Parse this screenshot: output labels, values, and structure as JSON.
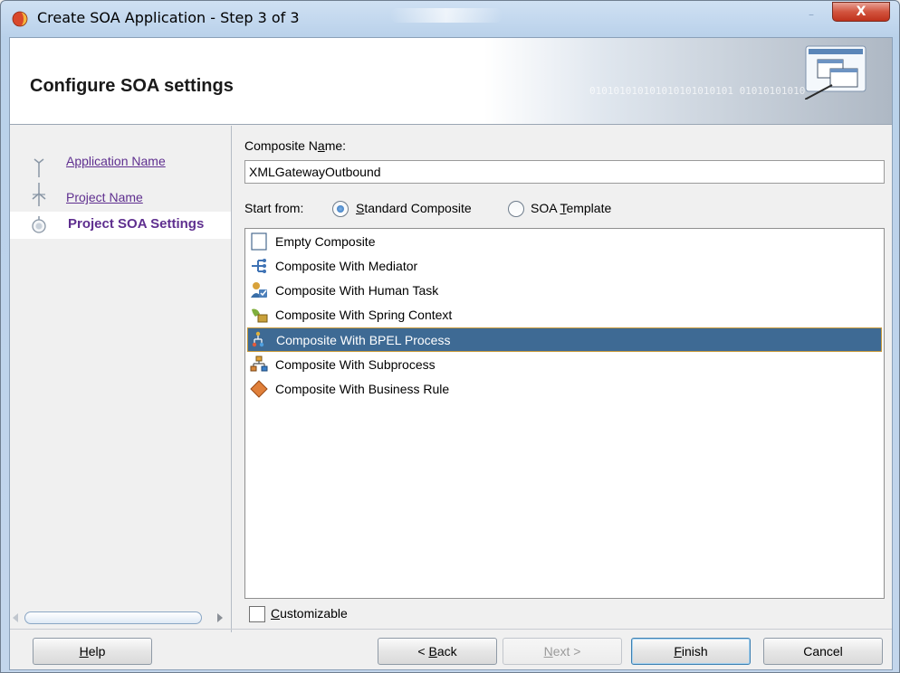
{
  "window": {
    "title": "Create SOA Application - Step 3 of 3",
    "minimize_glyph": "–",
    "close_glyph": "X"
  },
  "header": {
    "title": "Configure SOA settings",
    "decor_bits": "010101010101010101010101  01010101010"
  },
  "nav": {
    "items": [
      {
        "label": "Application Name",
        "state": "visited"
      },
      {
        "label": "Project Name",
        "state": "visited"
      },
      {
        "label": "Project SOA Settings",
        "state": "current"
      }
    ]
  },
  "form": {
    "composite_name_label_pre": "Composite N",
    "composite_name_label_mnemonic": "a",
    "composite_name_label_post": "me:",
    "composite_name_value": "XMLGatewayOutbound",
    "start_from_label": "Start from:",
    "radio_standard": {
      "mnemonic": "S",
      "rest": "tandard Composite",
      "checked": true
    },
    "radio_template": {
      "pre": "SOA ",
      "mnemonic": "T",
      "rest": "emplate",
      "checked": false
    },
    "composite_types": [
      {
        "label": "Empty Composite",
        "icon": "empty-composite-icon"
      },
      {
        "label": "Composite With Mediator",
        "icon": "mediator-icon"
      },
      {
        "label": "Composite With Human Task",
        "icon": "human-task-icon"
      },
      {
        "label": "Composite With Spring Context",
        "icon": "spring-context-icon"
      },
      {
        "label": "Composite With BPEL Process",
        "icon": "bpel-process-icon",
        "selected": true
      },
      {
        "label": "Composite With Subprocess",
        "icon": "subprocess-icon"
      },
      {
        "label": "Composite With Business Rule",
        "icon": "business-rule-icon"
      }
    ],
    "customizable": {
      "mnemonic": "C",
      "rest": "ustomizable",
      "checked": false
    }
  },
  "buttons": {
    "help": {
      "mnemonic": "H",
      "rest": "elp"
    },
    "back": {
      "pre": "< ",
      "mnemonic": "B",
      "rest": "ack"
    },
    "next": {
      "mnemonic": "N",
      "rest": "ext >",
      "enabled": false
    },
    "finish": {
      "mnemonic": "F",
      "rest": "inish"
    },
    "cancel": {
      "label": "Cancel"
    }
  },
  "colors": {
    "link": "#5f2f8f",
    "selection": "#3e6a94",
    "selection_border": "#c89a3a"
  }
}
